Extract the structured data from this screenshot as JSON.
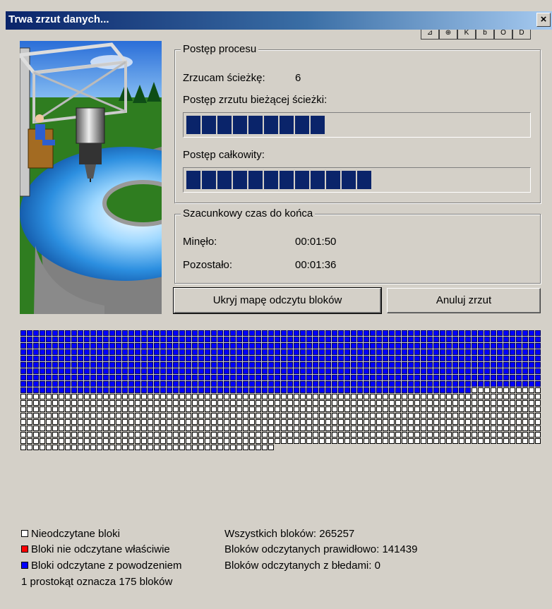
{
  "window": {
    "title": "Trwa zrzut danych...",
    "close_glyph": "×"
  },
  "background_toolbar": [
    "⊿",
    "⊕",
    "K",
    "b",
    "Ó",
    "D"
  ],
  "progress_group": {
    "legend": "Postęp procesu",
    "track_label": "Zrzucam ścieżkę:",
    "track_value": "6",
    "current_track_label": "Postęp zrzutu bieżącej ścieżki:",
    "current_track_progress": 0.4,
    "total_label": "Postęp całkowity:",
    "total_progress": 0.55
  },
  "time_group": {
    "legend": "Szacunkowy czas do końca",
    "elapsed_label": "Minęło:",
    "elapsed_value": "00:01:50",
    "remaining_label": "Pozostało:",
    "remaining_value": "00:01:36"
  },
  "buttons": {
    "hide_map": "Ukryj mapę odczytu bloków",
    "cancel": "Anuluj zrzut"
  },
  "block_map": {
    "total_cells": 1516,
    "read_ok_cells": 809,
    "read_error_cells": 0
  },
  "legend": {
    "unread": "Nieodczytane bloki",
    "bad": "Bloki nie odczytane właściwie",
    "good": "Bloki odczytane z powodzeniem",
    "scale": "1 prostokąt oznacza 175 bloków"
  },
  "stats": {
    "total": "Wszystkich bloków: 265257",
    "ok": "Bloków odczytanych prawidłowo: 141439",
    "errors": "Bloków odczytanych z błedami: 0"
  },
  "colors": {
    "title_gradient_start": "#0a246a",
    "progress_block": "#0a246a",
    "read_ok": "#0000ff",
    "read_bad": "#ff0000",
    "unread": "#ffffff",
    "face": "#d4d0c8"
  }
}
